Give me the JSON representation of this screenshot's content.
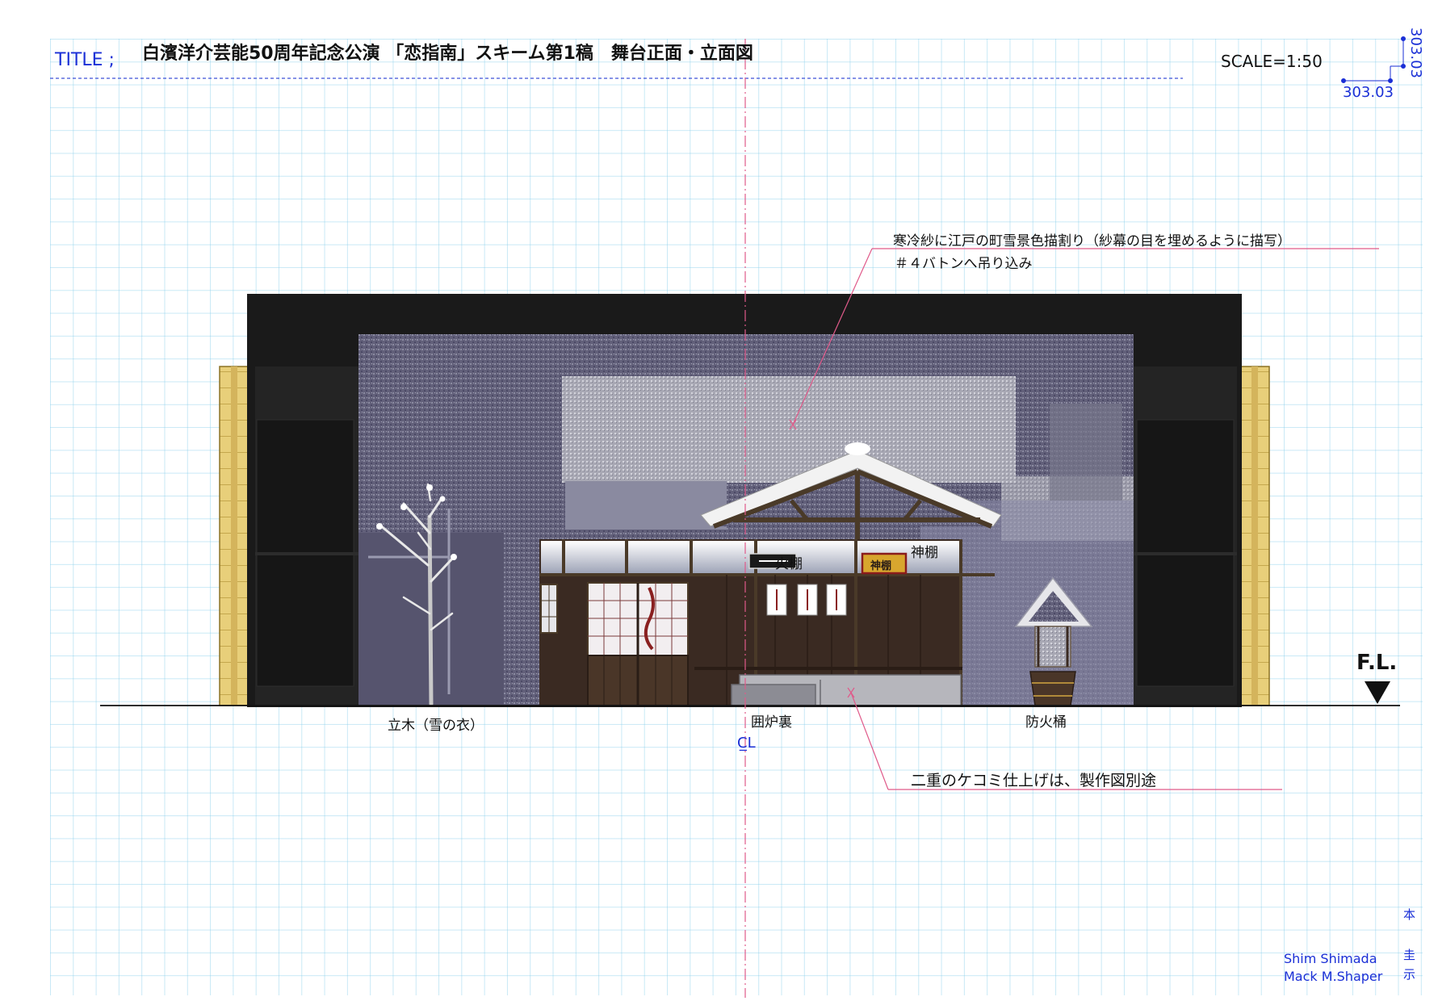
{
  "title": {
    "label": "TITLE ;",
    "text": "白濱洋介芸能50周年記念公演 「恋指南」スキーム第1稿　舞台正面・立面図"
  },
  "scale": "SCALE=1:50",
  "dimensions": {
    "horizontal": "303.03",
    "vertical": "303.03"
  },
  "floor_line": "F.L.",
  "centerline_mark": "C̲L",
  "labels": {
    "tree": "立木（雪の衣）",
    "hearth": "囲炉裏",
    "bucket": "防火桶",
    "fire_shelf": "火棚",
    "kamidana": "神棚",
    "kamidana_plate": "神棚"
  },
  "notes": {
    "scrim_line1": "寒冷紗に江戸の町雪景色描割り（紗幕の目を埋めるように描写）",
    "scrim_line2": "＃４バトンへ吊り込み",
    "platform": "二重のケコミ仕上げは、製作図別途"
  },
  "credits": {
    "author1": "Shim Shimada",
    "author2": "Mack M.Shaper"
  },
  "stamp": [
    "本",
    "圭",
    "示"
  ],
  "colors": {
    "grid": "#87ceeb",
    "title_blue": "#1a2fd6",
    "proscenium": "#1a1a1a",
    "wood_side": "#e8cf7a",
    "backdrop": "#5e5a78",
    "leader_pink": "#e05a8a",
    "house_dark": "#3a2a22"
  }
}
